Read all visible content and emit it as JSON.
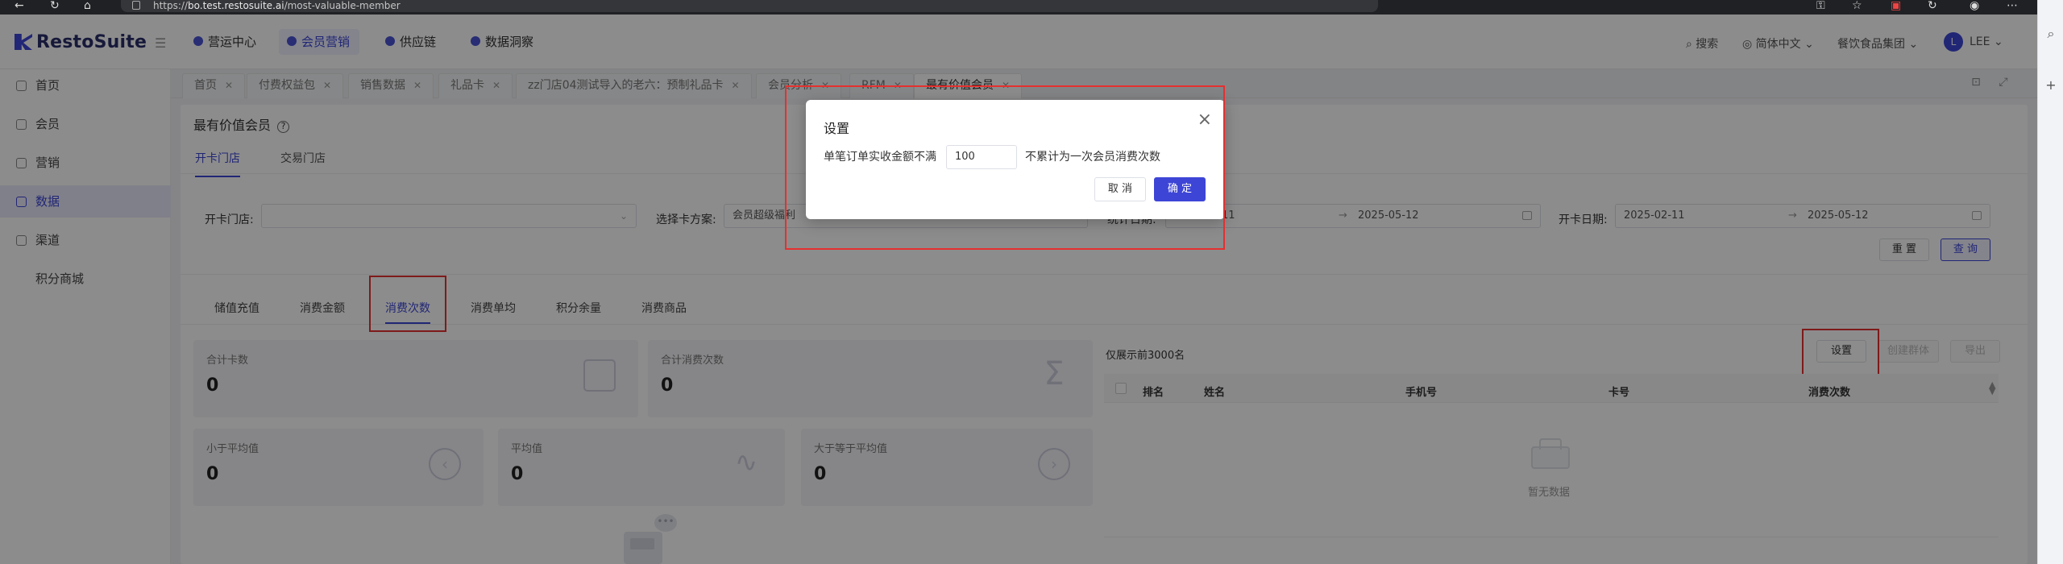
{
  "browser": {
    "url_prefix": "https://",
    "url_host": "bo.test.restosuite.ai",
    "url_path": "/most-valuable-member"
  },
  "app": {
    "logo": "RestoSuite"
  },
  "topnav": [
    {
      "label": "营运中心"
    },
    {
      "label": "会员营销"
    },
    {
      "label": "供应链"
    },
    {
      "label": "数据洞察"
    }
  ],
  "topright": {
    "search": "搜索",
    "lang": "简体中文",
    "org": "餐饮食品集团",
    "avatar": "L",
    "user": "LEE"
  },
  "sidebar": {
    "items": [
      {
        "label": "首页"
      },
      {
        "label": "会员"
      },
      {
        "label": "营销"
      },
      {
        "label": "数据"
      },
      {
        "label": "渠道"
      },
      {
        "label": "积分商城"
      }
    ]
  },
  "tabs": [
    {
      "label": "首页"
    },
    {
      "label": "付费权益包"
    },
    {
      "label": "销售数据"
    },
    {
      "label": "礼品卡"
    },
    {
      "label": "zz门店04测试导入的老六：预制礼品卡"
    },
    {
      "label": "会员分析"
    },
    {
      "label": "RFM"
    },
    {
      "label": "最有价值会员"
    }
  ],
  "page": {
    "title": "最有价值会员",
    "help": "?",
    "subtabs": [
      {
        "label": "开卡门店"
      },
      {
        "label": "交易门店"
      }
    ],
    "filters": {
      "store_label": "开卡门店:",
      "store_value": "",
      "plan_label": "选择卡方案:",
      "plan_value": "会员超级福利",
      "stat_label": "统计日期:",
      "stat_start": "2025-02-11",
      "stat_end": "2025-05-12",
      "open_label": "开卡日期:",
      "open_start": "2025-02-11",
      "open_end": "2025-05-12",
      "sep": "→"
    },
    "reset_label": "重 置",
    "query_label": "查 询",
    "metric_tabs": [
      {
        "label": "储值充值"
      },
      {
        "label": "消费金额"
      },
      {
        "label": "消费次数"
      },
      {
        "label": "消费单均"
      },
      {
        "label": "积分余量"
      },
      {
        "label": "消费商品"
      }
    ],
    "cards": {
      "total_cards_label": "合计卡数",
      "total_cards_value": "0",
      "total_visits_label": "合计消费次数",
      "total_visits_value": "0",
      "below_avg_label": "小于平均值",
      "below_avg_value": "0",
      "avg_label": "平均值",
      "avg_value": "0",
      "above_avg_label": "大于等于平均值",
      "above_avg_value": "0"
    },
    "table": {
      "note": "仅展示前3000名",
      "settings_label": "设置",
      "create_group_label": "创建群体",
      "export_label": "导出",
      "headers": [
        "排名",
        "姓名",
        "手机号",
        "卡号",
        "消费次数"
      ],
      "empty": "暂无数据"
    }
  },
  "modal": {
    "title": "设置",
    "text_before": "单笔订单实收金额不满",
    "value": "100",
    "text_after": "不累计为一次会员消费次数",
    "cancel": "取 消",
    "ok": "确 定",
    "close": "×"
  }
}
